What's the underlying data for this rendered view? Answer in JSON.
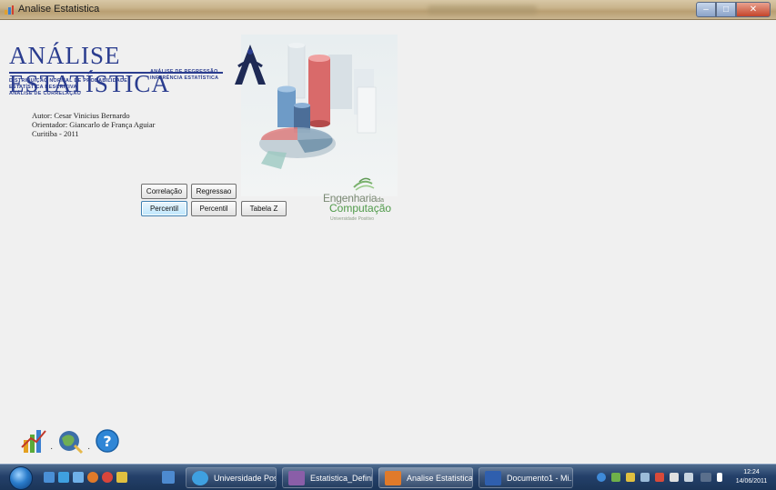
{
  "window": {
    "title": "Analise Estatistica",
    "buttons": {
      "minimize": "–",
      "maximize": "□",
      "close": "✕"
    }
  },
  "header": {
    "app_heading": "ANÁLISE ESTATÍSTICA",
    "topics_left": [
      "DISTRIBUIÇÃO NORMAL DE PROBABILIDADE",
      "ESTATÍSTICA DESCRITIVA",
      "ANÁLISE DE CORRELAÇÃO"
    ],
    "topics_right": [
      "ANÁLISE DE REGRESSÃO",
      "INFERÊNCIA ESTATÍSTICA"
    ]
  },
  "author_info": {
    "author": "Autor: Cesar Vinicius Bernardo",
    "advisor": "Orientador: Giancarlo de França Aguiar",
    "place_year": "Curitiba - 2011"
  },
  "buttons": {
    "correlacao": "Correlação",
    "regressao": "Regressao",
    "percentil_1": "Percentil",
    "percentil_2": "Percentil",
    "tabela_z": "Tabela Z"
  },
  "eng_logo": {
    "line1": "Engenharia",
    "line1_small": "da",
    "line2": "Computação",
    "line3": "Universidade Positivo"
  },
  "toolbar_icons": [
    "chart-tool-icon",
    "globe-tool-icon",
    "help-icon"
  ],
  "taskbar": {
    "tasks": [
      {
        "label": "Universidade Posi...",
        "icon": "ie-icon"
      },
      {
        "label": "Estatistica_Definiti...",
        "icon": "winrar-icon"
      },
      {
        "label": "Analise Estatistica",
        "icon": "app-icon"
      },
      {
        "label": "Documento1 - Mi...",
        "icon": "word-icon"
      }
    ],
    "clock_time": "12:24",
    "clock_date": "14/06/2011"
  },
  "colors": {
    "heading": "#2b3d8f",
    "taskbar": "#24406a",
    "client_bg": "#f0f0f0",
    "eng_green": "#4f9a49"
  }
}
